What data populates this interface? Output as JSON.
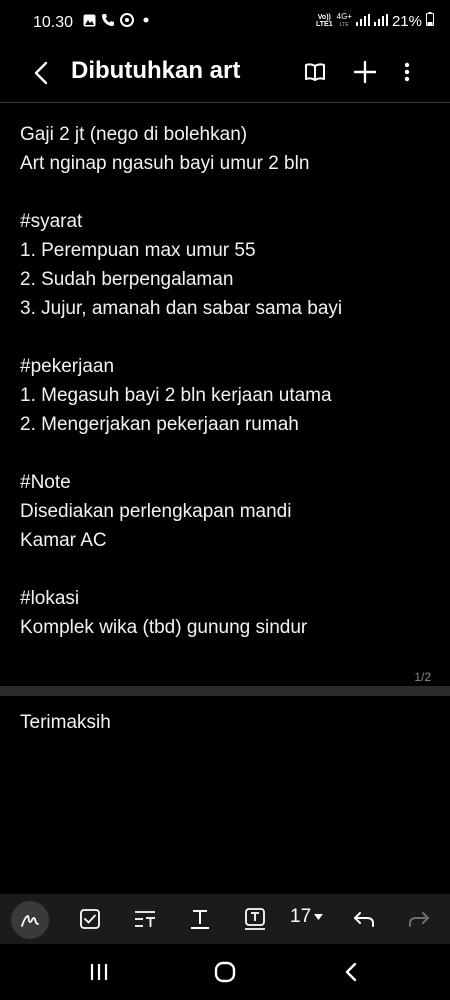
{
  "status": {
    "time": "10.30",
    "left_icons": [
      "gallery-icon",
      "call-icon",
      "vpn-icon",
      "dot-icon"
    ],
    "volte_line1": "Vo))",
    "volte_line2": "LTE1",
    "network_top": "4G+",
    "network_bottom": "LTE",
    "battery": "21%"
  },
  "header": {
    "title": "Dibutuhkan art",
    "back_icon": "chevron-left-icon",
    "actions": [
      "book-icon",
      "plus-icon",
      "more-vertical-icon"
    ]
  },
  "note": {
    "lines": [
      "Gaji 2 jt (nego di bolehkan)",
      "Art nginap ngasuh bayi umur 2 bln",
      "",
      "#syarat",
      "1. Perempuan max umur 55",
      "2. Sudah berpengalaman",
      "3. Jujur, amanah dan sabar sama bayi",
      "",
      "#pekerjaan",
      "1. Megasuh bayi 2 bln kerjaan utama",
      "2. Mengerjakan pekerjaan rumah",
      "",
      "#Note",
      "Disediakan perlengkapan mandi",
      "Kamar AC",
      "",
      "#lokasi",
      "Komplek wika (tbd) gunung sindur"
    ],
    "page_indicator": "1/2",
    "page2_text": "Terimaksih"
  },
  "toolbar": {
    "font_size": "17",
    "tools": [
      "pen-icon",
      "checkbox-icon",
      "text-style-icon",
      "text-format-icon",
      "text-box-icon",
      "font-size-dropdown",
      "undo-icon",
      "redo-icon"
    ]
  },
  "navbar": {
    "buttons": [
      "recents-icon",
      "home-icon",
      "back-icon"
    ]
  },
  "colors": {
    "background": "#000000",
    "text": "#f2f2f2",
    "toolbar_bg": "#1b1b1b",
    "disabled": "#6e6e6e"
  }
}
